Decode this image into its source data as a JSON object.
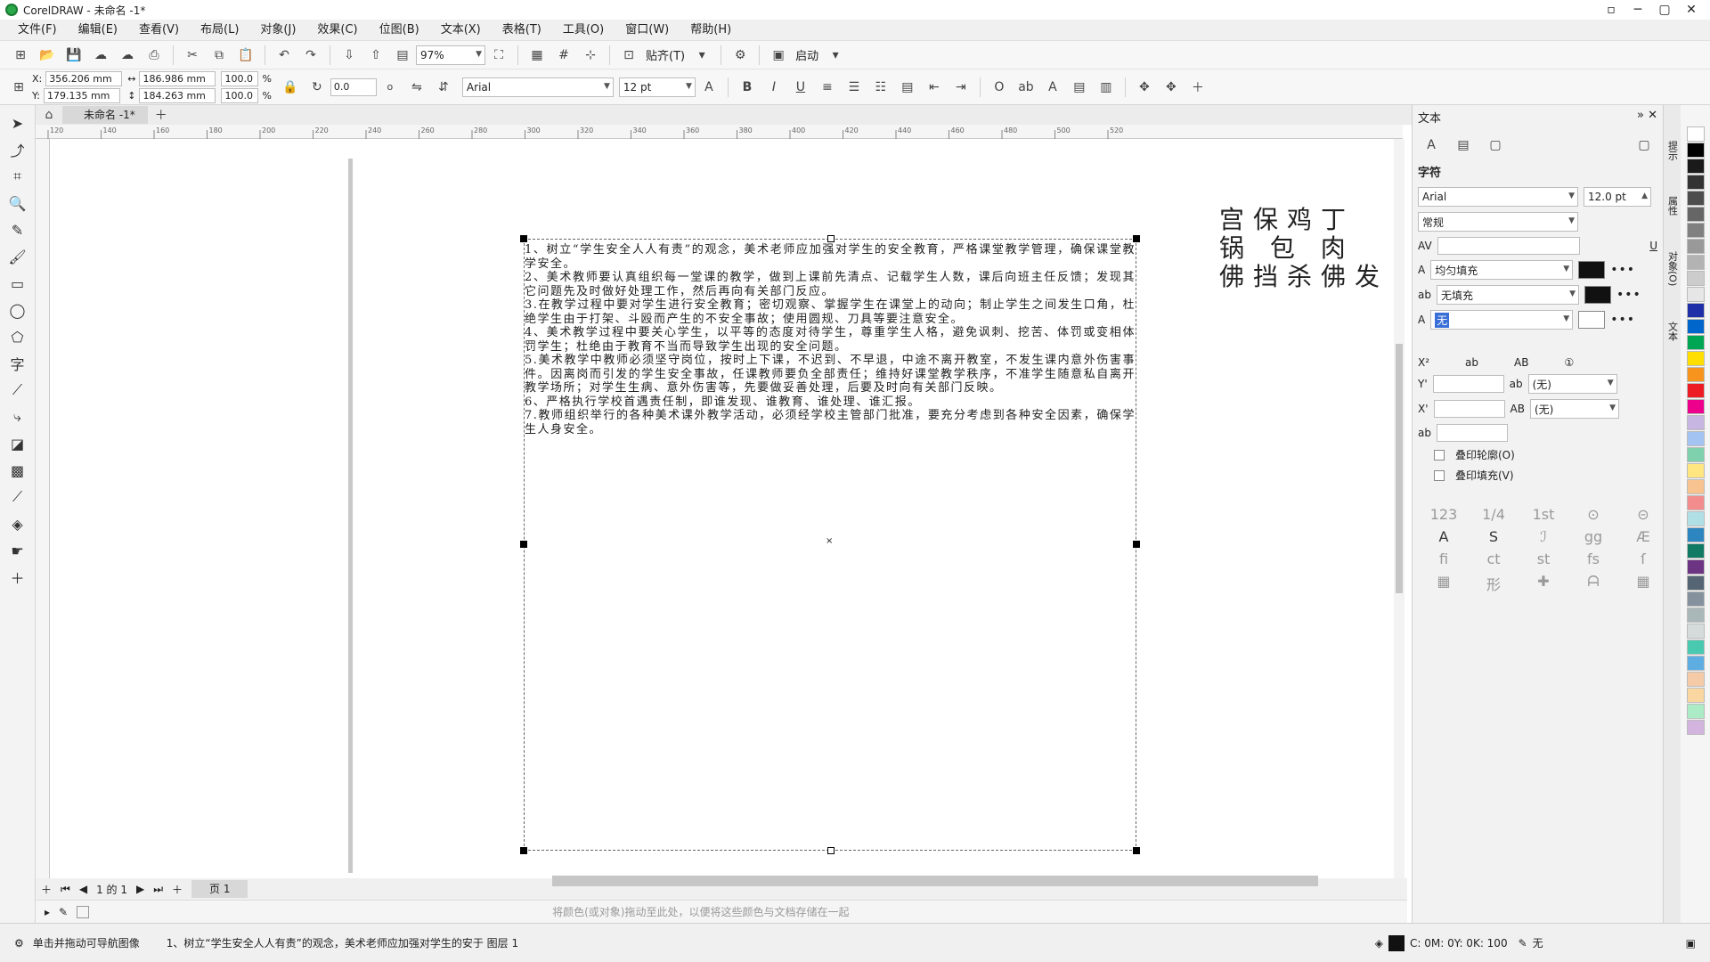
{
  "app": {
    "title": "CorelDRAW - 未命名 -1*",
    "window_controls": [
      "▫",
      "─",
      "▢",
      "✕"
    ]
  },
  "menu": [
    "文件(F)",
    "编辑(E)",
    "查看(V)",
    "布局(L)",
    "对象(J)",
    "效果(C)",
    "位图(B)",
    "文本(X)",
    "表格(T)",
    "工具(O)",
    "窗口(W)",
    "帮助(H)"
  ],
  "toolbar": {
    "zoom": "97%",
    "snap_label": "贴齐(T)",
    "launch_label": "启动"
  },
  "property_bar": {
    "x_label": "X:",
    "y_label": "Y:",
    "x_value": "356.206 mm",
    "y_value": "179.135 mm",
    "width_value": "186.986 mm",
    "height_value": "184.263 mm",
    "scale_x": "100.0",
    "scale_y": "100.0",
    "percent": "%",
    "rotation": "0.0",
    "font": "Arial",
    "font_size": "12 pt",
    "degree": "o"
  },
  "tools": [
    "pick",
    "shape",
    "crop",
    "zoom",
    "freehand",
    "artistic-media",
    "rectangle",
    "ellipse",
    "polygon",
    "text",
    "parallel-dimension",
    "connector",
    "drop-shadow",
    "transparency",
    "eyedropper",
    "interactive-fill",
    "smart-fill",
    "add"
  ],
  "document_tab": "未命名 -1*",
  "ruler_marks": [
    "120",
    "140",
    "160",
    "180",
    "200",
    "220",
    "240",
    "260",
    "280",
    "300",
    "320",
    "340",
    "360",
    "380",
    "400",
    "420",
    "440",
    "460",
    "480",
    "500",
    "520"
  ],
  "canvas": {
    "body_paragraphs": [
      "1、树立“学生安全人人有责”的观念，美术老师应加强对学生的安全教育，严格课堂教学管理，确保课堂教学安全。",
      "2、美术教师要认真组织每一堂课的教学，做到上课前先清点、记载学生人数，课后向班主任反馈；发现其它问题先及时做好处理工作，然后再向有关部门反应。",
      "3.在教学过程中要对学生进行安全教育；密切观察、掌握学生在课堂上的动向；制止学生之间发生口角，杜绝学生由于打架、斗殴而产生的不安全事故；使用圆规、刀具等要注意安全。",
      "4、美术教学过程中要关心学生，以平等的态度对待学生，尊重学生人格，避免讽刺、挖苦、体罚或变相体罚学生；杜绝由于教育不当而导致学生出现的安全问题。",
      "5.美术教学中教师必须坚守岗位，按时上下课，不迟到、不早退，中途不离开教室，不发生课内意外伤害事件。因离岗而引发的学生安全事故，任课教师要负全部责任；维持好课堂教学秩序，不准学生随意私自离开教学场所；对学生生病、意外伤害等，先要做妥善处理，后要及时向有关部门反映。",
      "6、严格执行学校首遇责任制，即谁发现、谁教育、谁处理、谁汇报。",
      "7.教师组织举行的各种美术课外教学活动，必须经学校主管部门批准，要充分考虑到各种安全因素，确保学生人身安全。"
    ],
    "side_text_lines": [
      "宫保鸡丁",
      "锅 包 肉",
      "佛挡杀佛发"
    ],
    "center_mark": "×"
  },
  "page_nav": {
    "position": "1 的 1",
    "page_tab": "页 1"
  },
  "color_hint": "将颜色(或对象)拖动至此处，以便将这些颜色与文档存储在一起",
  "status": {
    "left": "单击并拖动可导航图像",
    "object_info": "1、树立“学生安全人人有责”的观念，美术老师应加强对学生的安于 图层 1",
    "cmyk": "C: 0M: 0Y: 0K: 100",
    "outline": "无"
  },
  "docker": {
    "title": "文本",
    "section": "字符",
    "font": "Arial",
    "size": "12.0 pt",
    "style": "常规",
    "fill_type": "均匀填充",
    "bg_fill": "无填充",
    "outline": "无",
    "underline_none_1": "(无)",
    "underline_none_2": "(无)",
    "overprint_outline": "叠印轮廓(O)",
    "overprint_fill": "叠印填充(V)"
  },
  "right_tabs": [
    "提示",
    "属性",
    "对象(O)",
    "文本"
  ],
  "palette_colors": [
    "#ffffff",
    "#000000",
    "#1a1a1a",
    "#333333",
    "#4d4d4d",
    "#666666",
    "#808080",
    "#999999",
    "#b3b3b3",
    "#cccccc",
    "#e6e6e6",
    "#1f2fa8",
    "#0066cc",
    "#00a651",
    "#ffde00",
    "#f7941d",
    "#ed1c24",
    "#ec008c",
    "#c8b6e2",
    "#a3c4f3",
    "#7fd1ae",
    "#ffe680",
    "#f9c38f",
    "#f38c8c",
    "#b0e0e6",
    "#2e86c1",
    "#117a65",
    "#6c3483",
    "#566573",
    "#85929e",
    "#aab7b8",
    "#d5dbdb",
    "#48c9b0",
    "#5dade2",
    "#f5cba7",
    "#fad7a0",
    "#abebc6",
    "#d2b4de"
  ]
}
